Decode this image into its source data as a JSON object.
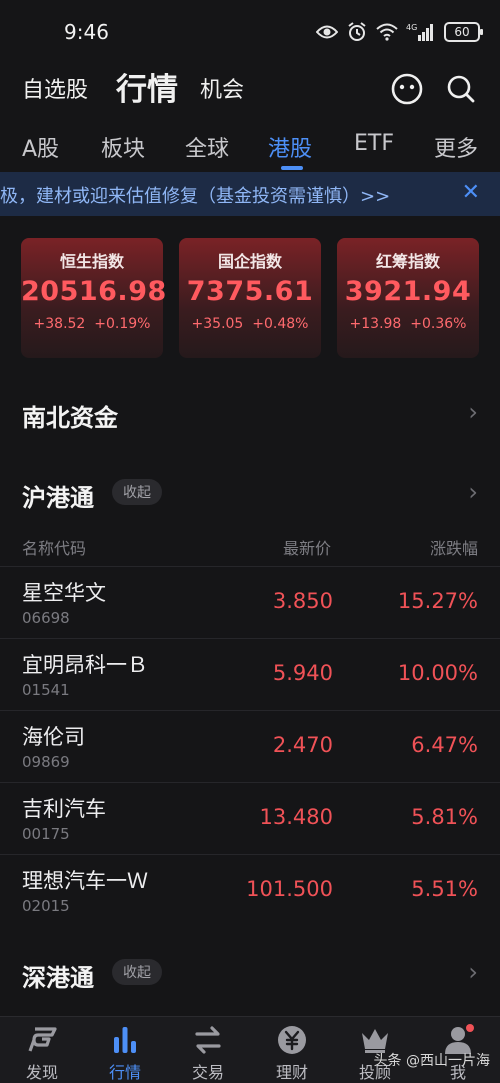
{
  "status": {
    "time": "9:46",
    "network": "4G",
    "battery": "60"
  },
  "top_nav": {
    "items": [
      "自选股",
      "行情",
      "机会"
    ],
    "active": "行情"
  },
  "tabs": [
    "A股",
    "板块",
    "全球",
    "港股",
    "ETF",
    "更多"
  ],
  "active_tab": "港股",
  "banner": {
    "text": "积极，建材或迎来估值修复（基金投资需谨慎）>>",
    "close": "✕"
  },
  "indices": [
    {
      "name": "恒生指数",
      "value": "20516.98",
      "change": "+38.52",
      "pct": "+0.19%"
    },
    {
      "name": "国企指数",
      "value": "7375.61",
      "change": "+35.05",
      "pct": "+0.48%"
    },
    {
      "name": "红筹指数",
      "value": "3921.94",
      "change": "+13.98",
      "pct": "+0.36%"
    }
  ],
  "sections": {
    "north_south": "南北资金",
    "hk_connect_sh": "沪港通",
    "hk_connect_sz": "深港通",
    "collapse_label": "收起"
  },
  "table": {
    "headers": {
      "name": "名称代码",
      "price": "最新价",
      "change": "涨跌幅"
    },
    "rows": [
      {
        "name": "星空华文",
        "code": "06698",
        "price": "3.850",
        "pct": "15.27%"
      },
      {
        "name": "宜明昂科一Ｂ",
        "code": "01541",
        "price": "5.940",
        "pct": "10.00%"
      },
      {
        "name": "海伦司",
        "code": "09869",
        "price": "2.470",
        "pct": "6.47%"
      },
      {
        "name": "吉利汽车",
        "code": "00175",
        "price": "13.480",
        "pct": "5.81%"
      },
      {
        "name": "理想汽车一Ｗ",
        "code": "02015",
        "price": "101.500",
        "pct": "5.51%"
      }
    ]
  },
  "bottom_nav": [
    {
      "label": "发现",
      "icon": "discover-icon"
    },
    {
      "label": "行情",
      "icon": "market-chart-icon"
    },
    {
      "label": "交易",
      "icon": "trade-arrows-icon"
    },
    {
      "label": "理财",
      "icon": "yuan-coin-icon"
    },
    {
      "label": "投顾",
      "icon": "crown-icon"
    },
    {
      "label": "我",
      "icon": "user-icon"
    }
  ],
  "watermark": "头条 @西山一片海",
  "colors": {
    "up": "#f05257",
    "accent": "#4d8ff6",
    "background": "#151517"
  }
}
